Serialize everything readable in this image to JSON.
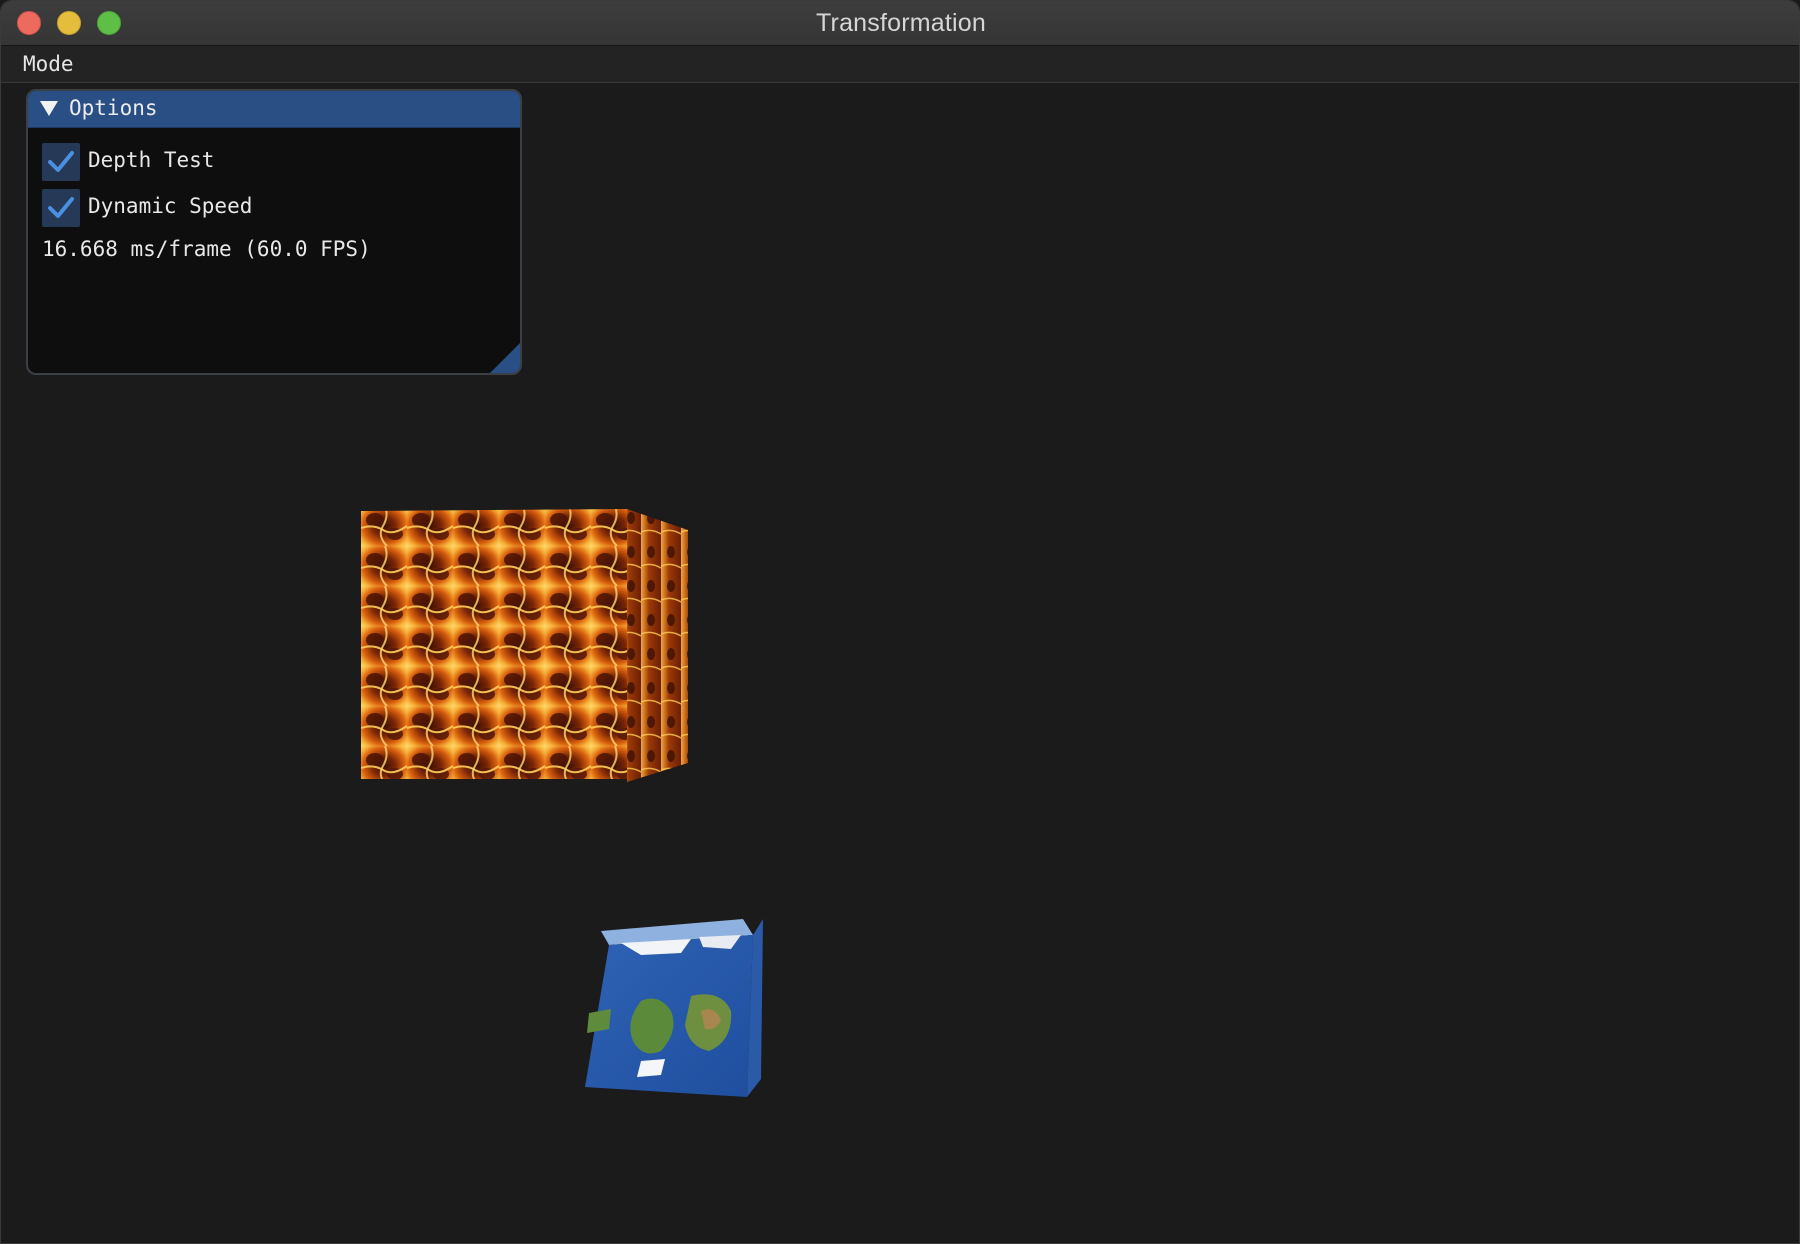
{
  "window": {
    "title": "Transformation"
  },
  "menu": {
    "items": [
      "Mode"
    ]
  },
  "options_panel": {
    "title": "Options",
    "depth_test": {
      "label": "Depth Test",
      "checked": true
    },
    "dynamic_speed": {
      "label": "Dynamic Speed",
      "checked": true
    },
    "fps_text": "16.668 ms/frame (60.0 FPS)"
  },
  "scene": {
    "objects": [
      {
        "name": "lava-cube",
        "texture": "lava"
      },
      {
        "name": "earth-cube",
        "texture": "earth"
      }
    ]
  },
  "colors": {
    "accent": "#2a4f85",
    "checkmark": "#4a90e2",
    "background": "#1b1b1b",
    "close": "#ed6a5e",
    "minimize": "#e4bd3d",
    "zoom": "#5fbe46"
  }
}
